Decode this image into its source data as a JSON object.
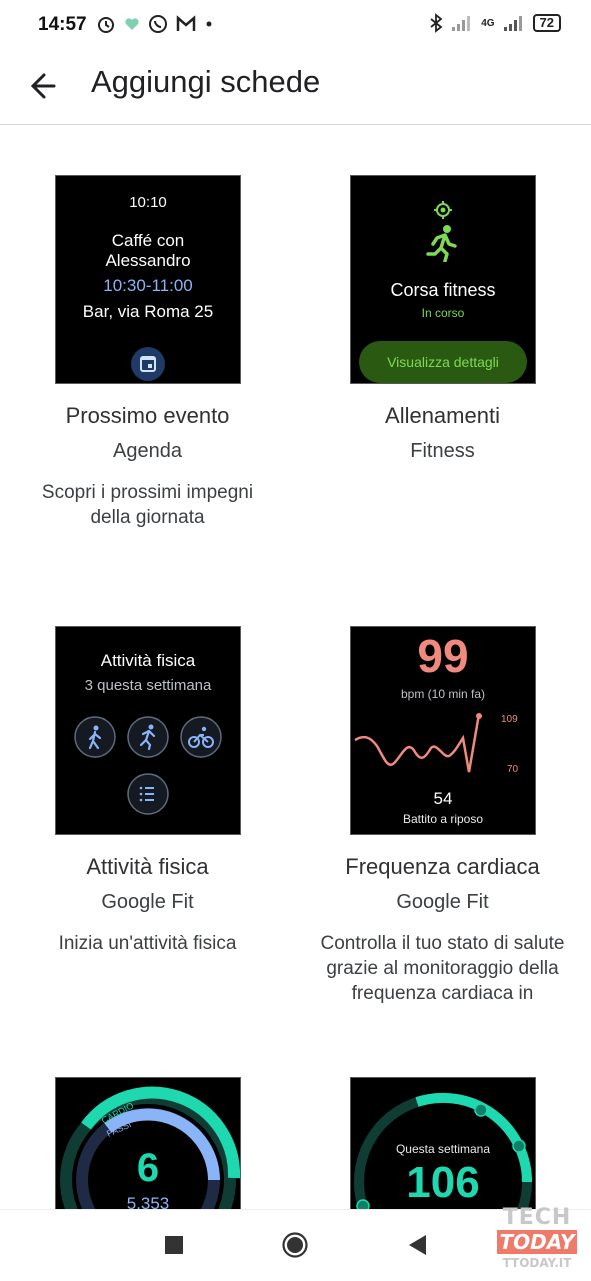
{
  "status_bar": {
    "time": "14:57",
    "battery": "72",
    "network": "4G"
  },
  "app_bar": {
    "title": "Aggiungi schede"
  },
  "cards": [
    {
      "title": "Prossimo evento",
      "source": "Agenda",
      "description": "Scopri i prossimi impegni della giornata",
      "preview": {
        "time": "10:10",
        "line1": "Caffé con",
        "line2": "Alessandro",
        "range": "10:30-11:00",
        "place": "Bar, via Roma 25"
      }
    },
    {
      "title": "Allenamenti",
      "source": "Fitness",
      "description": "",
      "preview": {
        "activity": "Corsa fitness",
        "status": "In corso",
        "button": "Visualizza dettagli"
      }
    },
    {
      "title": "Attività fisica",
      "source": "Google Fit",
      "description": "Inizia un'attività fisica",
      "preview": {
        "heading": "Attività fisica",
        "sub": "3 questa settimana"
      }
    },
    {
      "title": "Frequenza cardiaca",
      "source": "Google Fit",
      "description": "Controlla il tuo stato di salute grazie al monitoraggio della frequenza cardiaca in",
      "preview": {
        "bpm": "99",
        "bpm_label": "bpm (10 min fa)",
        "max": "109",
        "min": "70",
        "rest": "54",
        "rest_label": "Battito a riposo"
      }
    },
    {
      "preview": {
        "cardio_label": "CARDIO",
        "steps_label": "PASSI",
        "value": "6",
        "steps": "5.353"
      }
    },
    {
      "preview": {
        "label": "Questa settimana",
        "value": "106"
      }
    }
  ],
  "watermark": {
    "line1": "TECH",
    "line2": "TODAY",
    "line3": "TTODAY.IT"
  },
  "colors": {
    "accent_green": "#7ed957",
    "ring_teal": "#1ed8b0",
    "heart_red": "#f08a7e",
    "blue_text": "#8ab4f8"
  }
}
